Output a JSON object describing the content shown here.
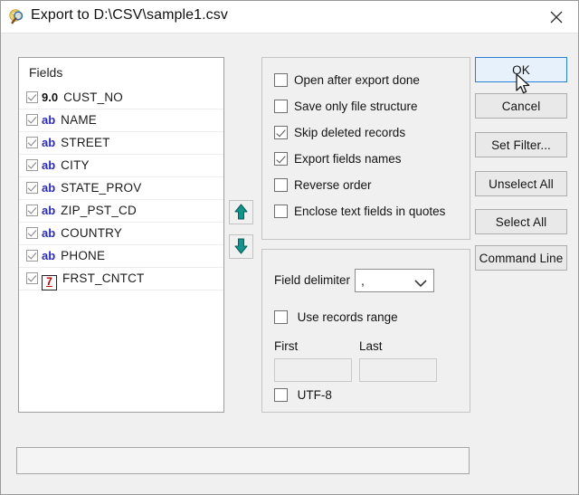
{
  "window": {
    "title": "Export to D:\\CSV\\sample1.csv",
    "icon": "magnifier-database-icon",
    "close_label": "✕"
  },
  "fields_panel": {
    "caption": "Fields",
    "items": [
      {
        "checked": true,
        "type": "9.0",
        "type_kind": "numeric",
        "name": "CUST_NO"
      },
      {
        "checked": true,
        "type": "ab",
        "type_kind": "text",
        "name": "NAME"
      },
      {
        "checked": true,
        "type": "ab",
        "type_kind": "text",
        "name": "STREET"
      },
      {
        "checked": true,
        "type": "ab",
        "type_kind": "text",
        "name": "CITY"
      },
      {
        "checked": true,
        "type": "ab",
        "type_kind": "text",
        "name": "STATE_PROV"
      },
      {
        "checked": true,
        "type": "ab",
        "type_kind": "text",
        "name": "ZIP_PST_CD"
      },
      {
        "checked": true,
        "type": "ab",
        "type_kind": "text",
        "name": "COUNTRY"
      },
      {
        "checked": true,
        "type": "ab",
        "type_kind": "text",
        "name": "PHONE"
      },
      {
        "checked": true,
        "type": "7",
        "type_kind": "date",
        "name": "FRST_CNTCT"
      }
    ]
  },
  "reorder": {
    "move_up": "move-up-arrow",
    "move_down": "move-down-arrow",
    "arrow_color": "#0f8a84"
  },
  "options": [
    {
      "label": "Open after export done",
      "checked": false
    },
    {
      "label": "Save only file structure",
      "checked": false
    },
    {
      "label": "Skip deleted records",
      "checked": true
    },
    {
      "label": "Export fields names",
      "checked": true
    },
    {
      "label": "Reverse order",
      "checked": false
    },
    {
      "label": "Enclose text fields in quotes",
      "checked": false
    }
  ],
  "delimiter_group": {
    "field_delimiter_label": "Field delimiter",
    "field_delimiter_value": ",",
    "use_records_range_label": "Use records range",
    "use_records_range_checked": false,
    "first_label": "First",
    "first_value": "",
    "last_label": "Last",
    "last_value": "",
    "utf8_label": "UTF-8",
    "utf8_checked": false
  },
  "buttons": [
    {
      "label": "OK",
      "state": "hovered"
    },
    {
      "label": "Cancel",
      "state": "normal"
    },
    {
      "label": "Set Filter...",
      "state": "normal"
    },
    {
      "label": "Unselect All",
      "state": "normal"
    },
    {
      "label": "Select All",
      "state": "normal"
    },
    {
      "label": "Command Line",
      "state": "normal"
    }
  ],
  "progress": {
    "value": "",
    "percent": 0
  },
  "colors": {
    "dialog_bg": "#f0f0f0",
    "accent": "#2a7fd4",
    "primary_fill": "#e6f1fb",
    "text_type": "#2b2bbe",
    "date_type": "#c00000"
  }
}
